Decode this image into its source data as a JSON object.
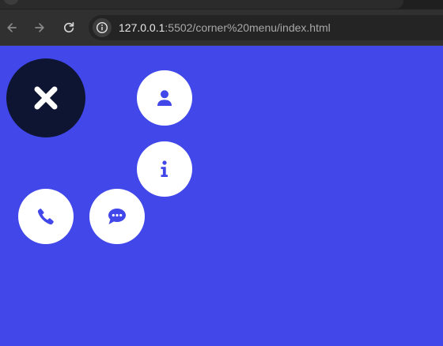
{
  "browser": {
    "back_icon": "arrow-left-icon",
    "forward_icon": "arrow-right-icon",
    "reload_icon": "reload-icon",
    "site_info_icon": "info-circle-icon",
    "url_host": "127.0.0.1",
    "url_rest": ":5502/corner%20menu/index.html"
  },
  "menu": {
    "toggle_icon": "close-x-icon",
    "items": [
      {
        "icon": "user-icon"
      },
      {
        "icon": "info-icon"
      },
      {
        "icon": "phone-icon"
      },
      {
        "icon": "chat-icon"
      }
    ]
  },
  "colors": {
    "page_background": "#4147e8",
    "toggle_background": "#0e1532",
    "item_background": "#ffffff",
    "icon_accent": "#4147e8",
    "browser_toolbar": "#303030"
  }
}
